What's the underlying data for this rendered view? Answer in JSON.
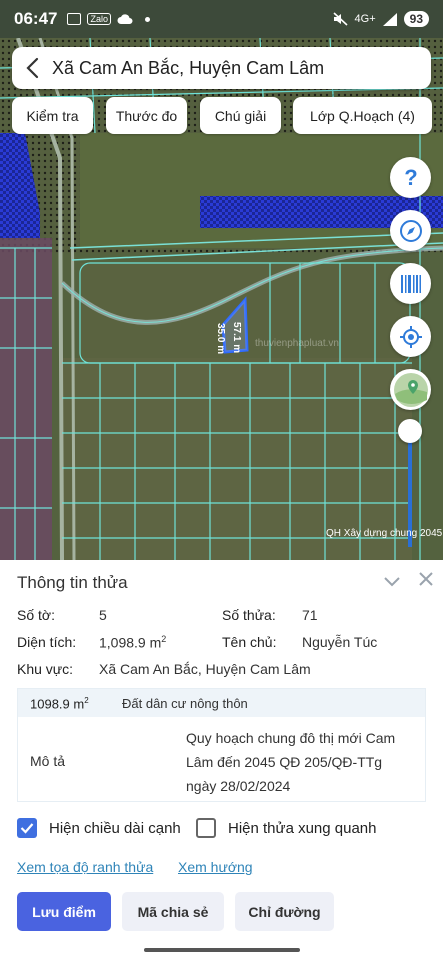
{
  "status_bar": {
    "time": "06:47",
    "zalo": "Zalo",
    "network": "4G+",
    "battery": "93"
  },
  "header": {
    "title": "Xã Cam An Bắc, Huyện Cam Lâm"
  },
  "chips": [
    {
      "label": "Kiểm tra"
    },
    {
      "label": "Thước đo"
    },
    {
      "label": "Chú giải"
    },
    {
      "label": "Lớp Q.Hoạch (4)"
    }
  ],
  "map": {
    "dimension_1": "57.1 m",
    "dimension_2": "35.0 m",
    "watermark": "thuvienphapluat.vn",
    "caption": "QH Xây dựng chung 2045"
  },
  "parcel": {
    "panel_title": "Thông tin thửa",
    "sheet_label": "Số tờ:",
    "sheet_value": "5",
    "plot_label": "Số thửa:",
    "plot_value": "71",
    "area_label": "Diện tích:",
    "area_value": "1,098.9 m",
    "area_unit_exp": "2",
    "owner_label": "Tên chủ:",
    "owner_value": "Nguyễn Túc",
    "region_label": "Khu vực:",
    "region_value": "Xã Cam An Bắc, Huyện Cam Lâm",
    "land_area": "1098.9 m",
    "land_area_exp": "2",
    "land_type": "Đất dân cư nông thôn",
    "desc_label": "Mô tả",
    "desc_value": "Quy hoạch chung đô thị mới Cam Lâm đến 2045 QĐ 205/QĐ-TTg ngày 28/02/2024"
  },
  "options": {
    "show_edge_length": "Hiện chiều dài cạnh",
    "show_edge_length_checked": true,
    "show_neighbors": "Hiện thửa xung quanh",
    "show_neighbors_checked": false
  },
  "links": {
    "view_coords": "Xem tọa độ ranh thửa",
    "view_direction": "Xem hướng"
  },
  "buttons": {
    "save_point": "Lưu điểm",
    "share_code": "Mã chia sẻ",
    "directions": "Chỉ đường"
  },
  "colors": {
    "accent": "#4a63e0",
    "link": "#2f84b8",
    "parcel_outline": "#2f6bff",
    "planning_band": "#2c3fd9"
  }
}
